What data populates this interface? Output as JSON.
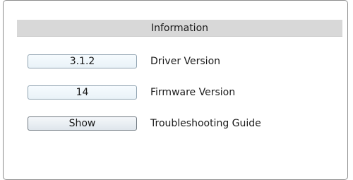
{
  "information_panel": {
    "title": "Information",
    "driver": {
      "value": "3.1.2",
      "label": "Driver Version"
    },
    "firmware": {
      "value": "14",
      "label": "Firmware Version"
    },
    "troubleshooting": {
      "button_label": "Show",
      "label": "Troubleshooting Guide"
    }
  }
}
